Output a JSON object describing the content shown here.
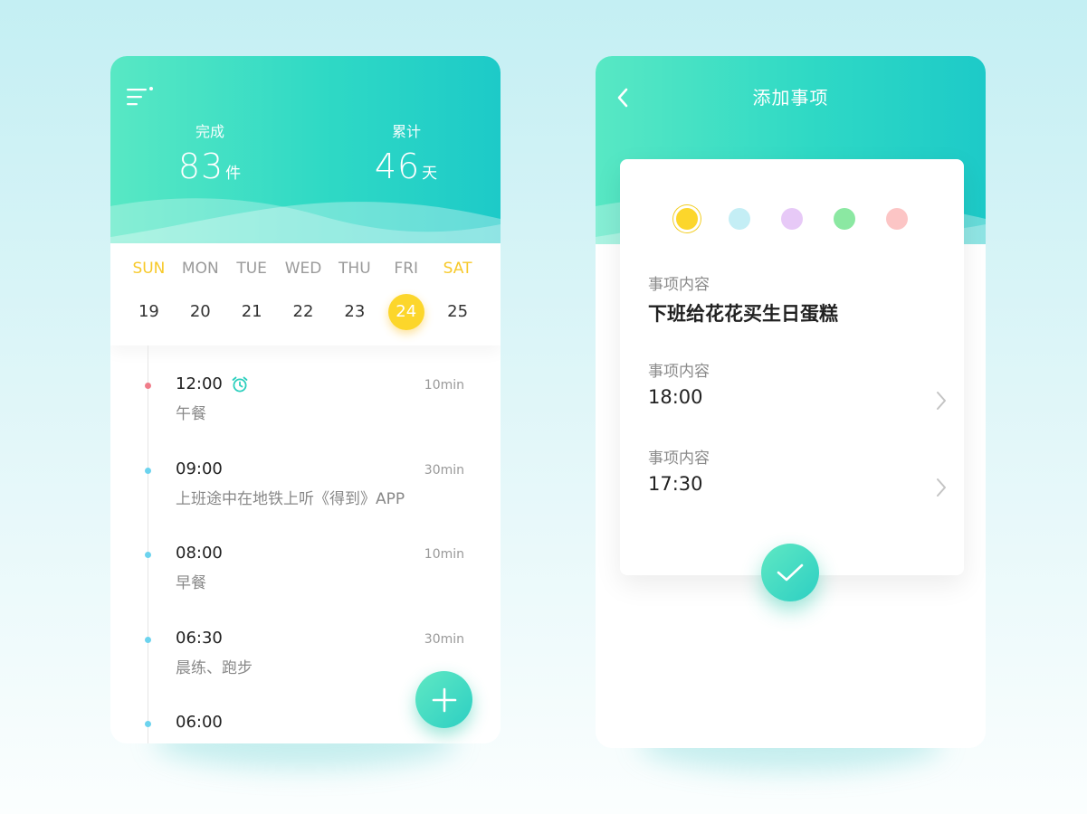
{
  "stats": {
    "done": {
      "label": "完成",
      "value": "83",
      "unit": "件"
    },
    "total": {
      "label": "累计",
      "value": "46",
      "unit": "天"
    }
  },
  "week": {
    "days": [
      {
        "name": "SUN",
        "num": "19"
      },
      {
        "name": "MON",
        "num": "20"
      },
      {
        "name": "TUE",
        "num": "21"
      },
      {
        "name": "WED",
        "num": "22"
      },
      {
        "name": "THU",
        "num": "23"
      },
      {
        "name": "FRI",
        "num": "24"
      },
      {
        "name": "SAT",
        "num": "25"
      }
    ]
  },
  "events": [
    {
      "time": "12:00",
      "title": "午餐",
      "duration": "10min"
    },
    {
      "time": "09:00",
      "title": "上班途中在地铁上听《得到》APP",
      "duration": "30min"
    },
    {
      "time": "08:00",
      "title": "早餐",
      "duration": "10min"
    },
    {
      "time": "06:30",
      "title": "晨练、跑步",
      "duration": "30min"
    },
    {
      "time": "06:00",
      "title": "",
      "duration": ""
    }
  ],
  "add_item": {
    "title": "添加事项",
    "colors": [
      "#fcd62b",
      "#c4eef5",
      "#e7c9f7",
      "#8be8a2",
      "#fcc5c5"
    ],
    "fields": [
      {
        "label": "事项内容",
        "value": "下班给花花买生日蛋糕"
      },
      {
        "label": "事项内容",
        "value": "18:00"
      },
      {
        "label": "事项内容",
        "value": "17:30"
      }
    ]
  },
  "icons": {
    "menu": "menu-icon",
    "alarm": "alarm-clock-icon",
    "add": "plus-icon",
    "back": "chevron-left-icon",
    "chevron": "chevron-right-icon",
    "confirm": "check-icon"
  },
  "theme": {
    "accent": "#2fd9c5",
    "highlight": "#fcd62b",
    "weekend": "#f7c92a"
  }
}
